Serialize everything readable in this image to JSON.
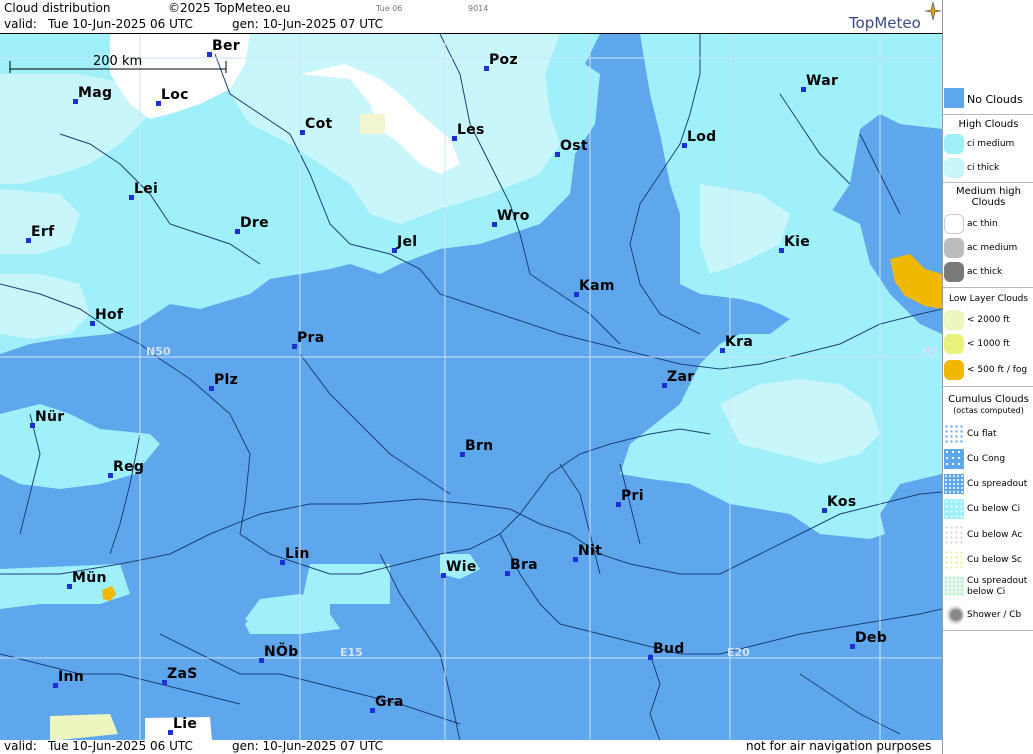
{
  "header": {
    "title": "Cloud distribution",
    "copyright": "©2025 TopMeteo.eu",
    "day_code": "Tue 06",
    "code": "9014",
    "valid_label": "valid:",
    "valid_value": "Tue  10-Jun-2025  06 UTC",
    "gen_value": "gen: 10-Jun-2025 07 UTC",
    "logo": "TopMeteo"
  },
  "footer": {
    "valid_label": "valid:",
    "valid_value": "Tue  10-Jun-2025  06 UTC",
    "gen_value": "gen: 10-Jun-2025 07 UTC",
    "disclaimer": "not for air navigation purposes"
  },
  "map": {
    "scale_label": "200 km",
    "grid_labels": {
      "n50_left": "N50",
      "n50_right": "N5",
      "e15": "E15",
      "e20": "E20"
    },
    "cities": [
      {
        "name": "Ber"
      },
      {
        "name": "Poz"
      },
      {
        "name": "Mag"
      },
      {
        "name": "Loc"
      },
      {
        "name": "War"
      },
      {
        "name": "Cot"
      },
      {
        "name": "Les"
      },
      {
        "name": "Lod"
      },
      {
        "name": "Ost"
      },
      {
        "name": "Lei"
      },
      {
        "name": "Wro"
      },
      {
        "name": "Erf"
      },
      {
        "name": "Dre"
      },
      {
        "name": "Jel"
      },
      {
        "name": "Kie"
      },
      {
        "name": "Kam"
      },
      {
        "name": "Hof"
      },
      {
        "name": "Pra"
      },
      {
        "name": "Kra"
      },
      {
        "name": "Zar"
      },
      {
        "name": "Plz"
      },
      {
        "name": "Nür"
      },
      {
        "name": "Brn"
      },
      {
        "name": "Reg"
      },
      {
        "name": "Pri"
      },
      {
        "name": "Kos"
      },
      {
        "name": "Lin"
      },
      {
        "name": "Nit"
      },
      {
        "name": "Bra"
      },
      {
        "name": "Wie"
      },
      {
        "name": "Mün"
      },
      {
        "name": "Bud"
      },
      {
        "name": "Deb"
      },
      {
        "name": "NÖb"
      },
      {
        "name": "ZaS"
      },
      {
        "name": "Inn"
      },
      {
        "name": "Gra"
      },
      {
        "name": "Lie"
      }
    ],
    "colors": {
      "no_clouds": "#5ea7ec",
      "ci_medium": "#9ff0fa",
      "ci_thick": "#c9f6fb",
      "clear": "#ffffff",
      "low_fog": "#f0b800",
      "low_2000": "#eef6bf",
      "cu_below_ci": "#bff6f8",
      "city_dot": "#1e2fd6",
      "lines": "#1d3f7a"
    }
  },
  "legend": {
    "no_clouds": "No Clouds",
    "high_clouds": "High Clouds",
    "ci_medium": "ci medium",
    "ci_thick": "ci thick",
    "medium_high_1": "Medium high",
    "medium_high_2": "Clouds",
    "ac_thin": "ac thin",
    "ac_medium": "ac medium",
    "ac_thick": "ac thick",
    "low_layer": "Low Layer Clouds",
    "lt2000": "< 2000 ft",
    "lt1000": "< 1000 ft",
    "lt500": "< 500 ft / fog",
    "cumulus_1": "Cumulus Clouds",
    "cumulus_2": "(octas computed)",
    "cu_flat": "Cu flat",
    "cu_cong": "Cu Cong",
    "cu_spreadout": "Cu spreadout",
    "cu_below_ci": "Cu below Ci",
    "cu_below_ac": "Cu below Ac",
    "cu_below_sc": "Cu below Sc",
    "cu_spreadout_below_ci_1": "Cu spreadout",
    "cu_spreadout_below_ci_2": "below Ci",
    "shower_cb": "Shower / Cb"
  }
}
